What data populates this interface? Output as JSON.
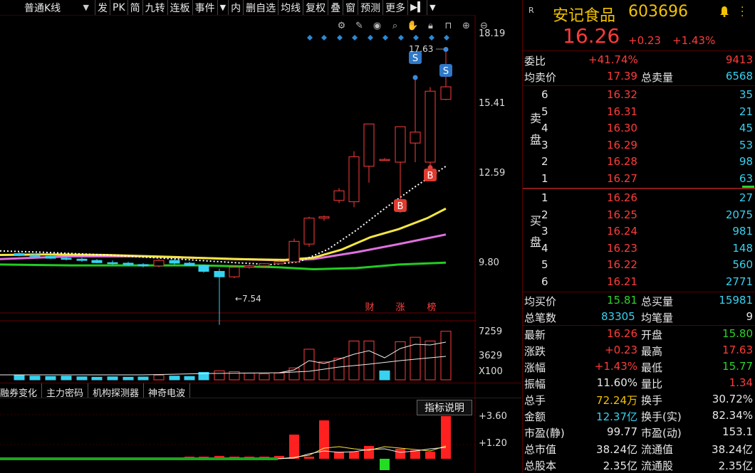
{
  "toolbar": {
    "period": "普通K线",
    "buttons": [
      "发",
      "PK",
      "简",
      "九转",
      "连板",
      "事件",
      "内",
      "删自选",
      "均线",
      "复权",
      "叠",
      "窗",
      "预测",
      "更多"
    ]
  },
  "chart_tools": [
    "gear-icon",
    "pen-icon",
    "eye-icon",
    "search-icon",
    "hand-icon",
    "lock-icon",
    "lock-icon",
    "zoom-in-icon",
    "zoom-out-icon"
  ],
  "price_axis": [
    "18.19",
    "15.41",
    "12.59",
    "9.80"
  ],
  "vol_axis": [
    "7259",
    "3629",
    "X100"
  ],
  "ind_axis": [
    "+3.60",
    "+1.20"
  ],
  "annotations": {
    "high_label": "17.63",
    "low_label": "←7.54",
    "sell_marker": "S",
    "buy_marker": "B",
    "event_tags": [
      "财",
      "涨",
      "榜"
    ]
  },
  "indicator_tabs": [
    "融券变化",
    "主力密码",
    "机构探测器",
    "神奇电波"
  ],
  "indicator_help": "指标说明",
  "quote": {
    "badge": "R",
    "name": "安记食品",
    "code": "603696",
    "price": "16.26",
    "change": "+0.23",
    "change_pct": "+1.43%",
    "weibi_label": "委比",
    "weibi_value": "+41.74%",
    "weibi_diff": "9413",
    "ask_avg_label": "均卖价",
    "ask_avg": "17.39",
    "ask_total_label": "总卖量",
    "ask_total": "6568",
    "sell_side_label": "卖盘",
    "buy_side_label": "买盘",
    "asks": [
      {
        "level": "6",
        "price": "16.32",
        "vol": "35"
      },
      {
        "level": "5",
        "price": "16.31",
        "vol": "21"
      },
      {
        "level": "4",
        "price": "16.30",
        "vol": "45"
      },
      {
        "level": "3",
        "price": "16.29",
        "vol": "53"
      },
      {
        "level": "2",
        "price": "16.28",
        "vol": "98"
      },
      {
        "level": "1",
        "price": "16.27",
        "vol": "63"
      }
    ],
    "bids": [
      {
        "level": "1",
        "price": "16.26",
        "vol": "27"
      },
      {
        "level": "2",
        "price": "16.25",
        "vol": "2075"
      },
      {
        "level": "3",
        "price": "16.24",
        "vol": "981"
      },
      {
        "level": "4",
        "price": "16.23",
        "vol": "148"
      },
      {
        "level": "5",
        "price": "16.22",
        "vol": "560"
      },
      {
        "level": "6",
        "price": "16.21",
        "vol": "2771"
      }
    ],
    "bid_avg_label": "均买价",
    "bid_avg": "15.81",
    "bid_total_label": "总买量",
    "bid_total": "15981",
    "trades_label": "总笔数",
    "trades": "83305",
    "avg_trade_label": "均笔量",
    "avg_trade": "9",
    "stats": [
      {
        "l1": "最新",
        "v1": "16.26",
        "c1": "red",
        "l2": "开盘",
        "v2": "15.80",
        "c2": "green"
      },
      {
        "l1": "涨跌",
        "v1": "+0.23",
        "c1": "red",
        "l2": "最高",
        "v2": "17.63",
        "c2": "red"
      },
      {
        "l1": "涨幅",
        "v1": "+1.43%",
        "c1": "red",
        "l2": "最低",
        "v2": "15.77",
        "c2": "green"
      },
      {
        "l1": "振幅",
        "v1": "11.60%",
        "c1": "white",
        "l2": "量比",
        "v2": "1.34",
        "c2": "red"
      },
      {
        "l1": "总手",
        "v1": "72.24万",
        "c1": "yellow",
        "l2": "换手",
        "v2": "30.72%",
        "c2": "white"
      },
      {
        "l1": "金额",
        "v1": "12.37亿",
        "c1": "cyan",
        "l2": "换手(实)",
        "v2": "82.34%",
        "c2": "white"
      },
      {
        "l1": "市盈(静)",
        "v1": "99.77",
        "c1": "white",
        "l2": "市盈(动)",
        "v2": "153.1",
        "c2": "white"
      },
      {
        "l1": "总市值",
        "v1": "38.24亿",
        "c1": "white",
        "l2": "流通值",
        "v2": "38.24亿",
        "c2": "white"
      },
      {
        "l1": "总股本",
        "v1": "2.35亿",
        "c1": "white",
        "l2": "流通股",
        "v2": "2.35亿",
        "c2": "white"
      }
    ]
  },
  "colors": {
    "up": "#ff3b3b",
    "down": "#36d2f0",
    "ma5": "#ffffff",
    "ma10": "#f5e642",
    "ma20": "#e070e0",
    "ma60": "#22cc22"
  }
}
